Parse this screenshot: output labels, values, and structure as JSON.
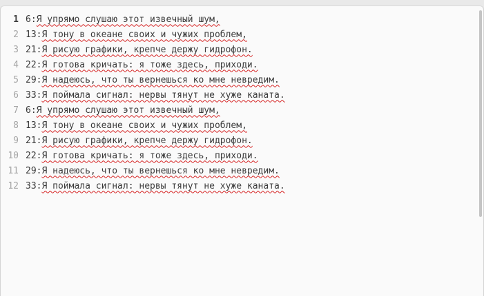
{
  "editor": {
    "lines": [
      {
        "number": "1",
        "prefix": "6:",
        "text": "Я упрямо слушаю этот извечный шум,"
      },
      {
        "number": "2",
        "prefix": "13:",
        "text": "Я тону в океане своих и чужих проблем,"
      },
      {
        "number": "3",
        "prefix": "21:",
        "text": "Я рисую графики, крепче держу гидрофон."
      },
      {
        "number": "4",
        "prefix": "22:",
        "text": "Я готова кричать: я тоже здесь, приходи."
      },
      {
        "number": "5",
        "prefix": "29:",
        "text": "Я надеюсь, что ты вернешься ко мне невредим."
      },
      {
        "number": "6",
        "prefix": "33:",
        "text": "Я поймала сигнал: нервы тянут не хуже каната."
      },
      {
        "number": "7",
        "prefix": "6:",
        "text": "Я упрямо слушаю этот извечный шум,"
      },
      {
        "number": "8",
        "prefix": "13:",
        "text": "Я тону в океане своих и чужих проблем,"
      },
      {
        "number": "9",
        "prefix": "21:",
        "text": "Я рисую графики, крепче держу гидрофон."
      },
      {
        "number": "10",
        "prefix": "22:",
        "text": "Я готова кричать: я тоже здесь, приходи."
      },
      {
        "number": "11",
        "prefix": "29:",
        "text": "Я надеюсь, что ты вернешься ко мне невредим."
      },
      {
        "number": "12",
        "prefix": "33:",
        "text": "Я поймала сигнал: нервы тянут не хуже каната."
      }
    ]
  },
  "colors": {
    "spellcheck_underline": "#d62424",
    "text": "#3a3a3a",
    "gutter": "#a4a4a4"
  }
}
